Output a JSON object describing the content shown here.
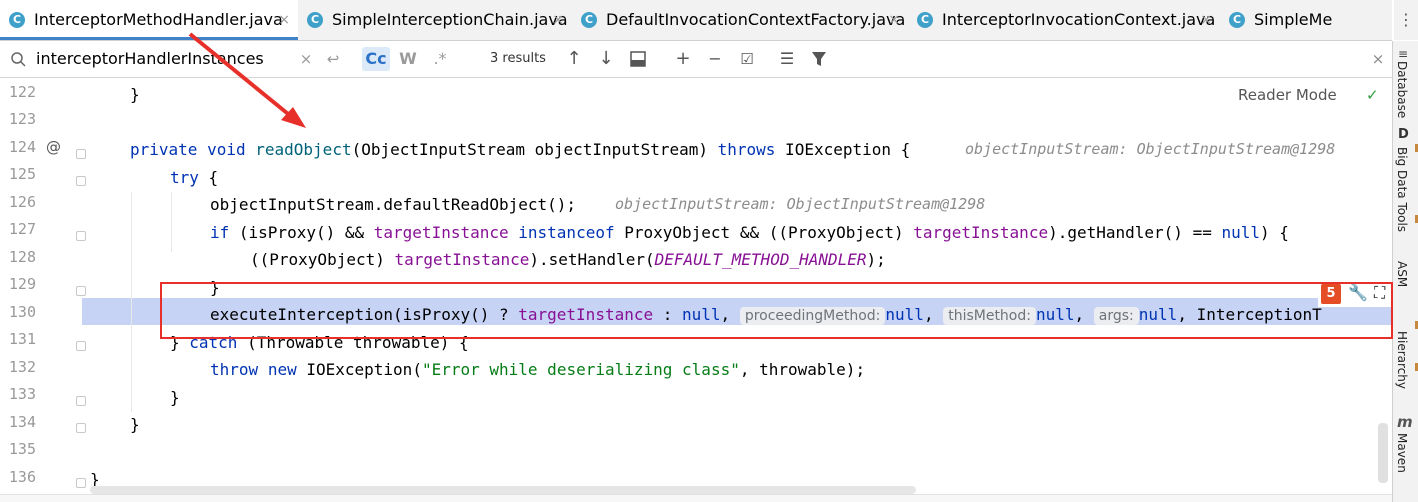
{
  "tabs": [
    {
      "name": "InterceptorMethodHandler.java",
      "active": true
    },
    {
      "name": "SimpleInterceptionChain.java",
      "active": false
    },
    {
      "name": "DefaultInvocationContextFactory.java",
      "active": false
    },
    {
      "name": "InterceptorInvocationContext.java",
      "active": false
    },
    {
      "name": "SimpleMe",
      "active": false
    }
  ],
  "tab_close_glyph": "×",
  "search": {
    "query": "interceptorHandlerInstances",
    "results": "3 results",
    "match_case": "Cc",
    "words": "W",
    "regex": ".*"
  },
  "editor": {
    "reader_mode": "Reader Mode",
    "gutter_annotation": "@",
    "line_numbers": [
      "122",
      "123",
      "124",
      "125",
      "126",
      "127",
      "128",
      "129",
      "130",
      "131",
      "132",
      "133",
      "134",
      "135",
      "136"
    ],
    "lines": {
      "l122": {
        "brace": "}"
      },
      "l124": {
        "private": "private",
        "void": "void",
        "method": "readObject",
        "params": "(ObjectInputStream objectInputStream) ",
        "throws": "throws",
        "rest": " IOException {",
        "hint": "objectInputStream: ObjectInputStream@1298"
      },
      "l125": {
        "try": "try",
        "rest": " {"
      },
      "l126": {
        "text": "objectInputStream.defaultReadObject();",
        "hint": "objectInputStream: ObjectInputStream@1298"
      },
      "l127": {
        "if": "if",
        "a": " (isProxy() && ",
        "f1": "targetInstance",
        "sp": " ",
        "instanceof": "instanceof",
        "b": " ProxyObject && ((ProxyObject) ",
        "f2": "targetInstance",
        "c": ").getHandler() == ",
        "null": "null",
        "d": ") {"
      },
      "l128": {
        "a": "((ProxyObject) ",
        "f": "targetInstance",
        "b": ").setHandler(",
        "const": "DEFAULT_METHOD_HANDLER",
        "c": ");"
      },
      "l129": {
        "brace": "}"
      },
      "l130": {
        "a": "executeInterception(isProxy() ? ",
        "f": "targetInstance",
        "b": " : ",
        "null1": "null",
        "c": ", ",
        "p1": "proceedingMethod:",
        "null2": "null",
        "d": ", ",
        "p2": "thisMethod:",
        "null3": "null",
        "e": ", ",
        "p3": "args:",
        "null4": "null",
        "g": ", InterceptionT"
      },
      "l131": {
        "a": "} ",
        "catch": "catch",
        "b": " (Throwable throwable) {"
      },
      "l132": {
        "throw": "throw",
        "sp": " ",
        "new": "new",
        "a": " IOException(",
        "str": "\"Error while deserializing class\"",
        "b": ", throwable);"
      },
      "l133": {
        "brace": "}"
      },
      "l134": {
        "brace": "}"
      },
      "l136": {
        "brace": "}"
      }
    }
  },
  "right_tools": [
    "Database",
    "Big Data Tools",
    "ASM",
    "Hierarchy",
    "Maven"
  ],
  "colors": {
    "accent": "#4083c9",
    "selection": "#c6d3f5",
    "annotation_red": "#e8302a",
    "keyword": "#0033b3",
    "field": "#871094",
    "string": "#067d17"
  }
}
